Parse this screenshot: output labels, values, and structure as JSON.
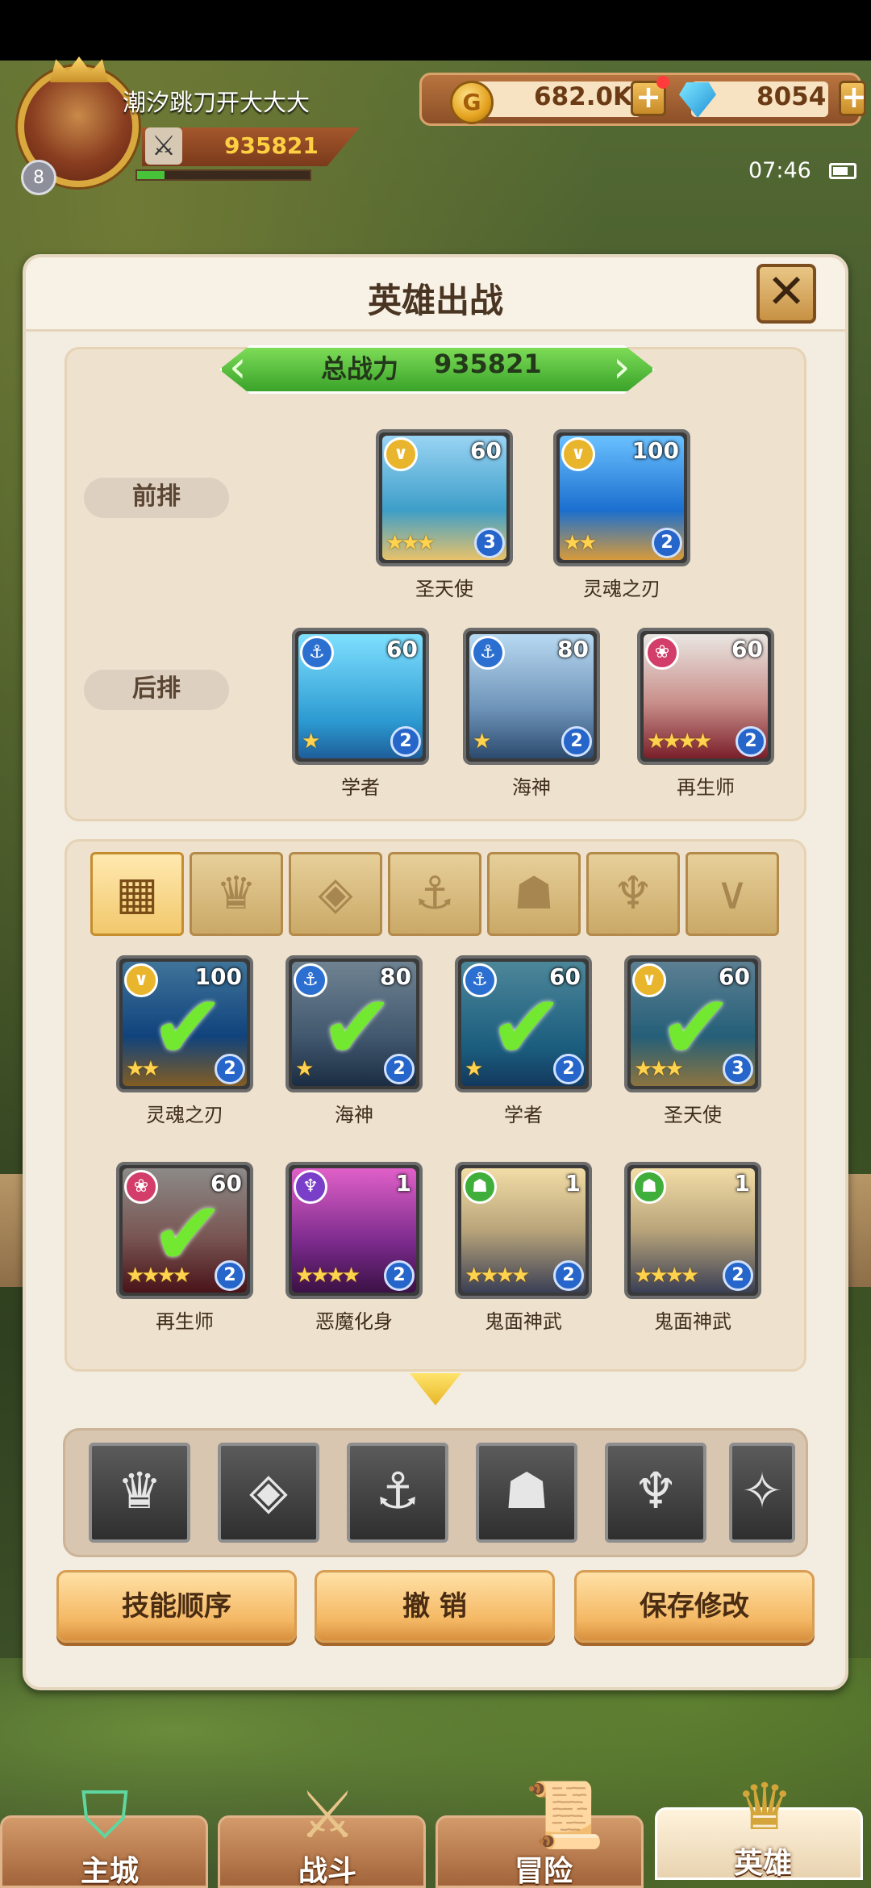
{
  "player": {
    "name": "潮汐跳刀开大大大",
    "power": "935821",
    "level": "8",
    "exp_fraction": 0.16
  },
  "resources": {
    "gold": "682.0K",
    "gems": "8054",
    "gold_icon": "G"
  },
  "status": {
    "time": "07:46"
  },
  "panel": {
    "title": "英雄出战",
    "close": "✕"
  },
  "lineup": {
    "total_power_label": "总战力",
    "total_power_value": "935821",
    "front_label": "前排",
    "back_label": "后排",
    "front": [
      {
        "name": "圣天使",
        "level": "60",
        "stars": "★★★",
        "rank": "3",
        "faction": "light"
      },
      {
        "name": "灵魂之刃",
        "level": "100",
        "stars": "★★",
        "rank": "2",
        "faction": "light"
      }
    ],
    "back": [
      {
        "name": "学者",
        "level": "60",
        "stars": "★",
        "rank": "2",
        "faction": "water"
      },
      {
        "name": "海神",
        "level": "80",
        "stars": "★",
        "rank": "2",
        "faction": "water"
      },
      {
        "name": "再生师",
        "level": "60",
        "stars": "★★★★",
        "rank": "2",
        "faction": "nature"
      }
    ]
  },
  "filters": [
    "grid-icon",
    "crown-icon",
    "diamond-icon",
    "anchor-icon",
    "beast-icon",
    "horns-icon",
    "wing-icon"
  ],
  "roster": [
    {
      "name": "灵魂之刃",
      "level": "100",
      "stars": "★★",
      "rank": "2",
      "selected": true
    },
    {
      "name": "海神",
      "level": "80",
      "stars": "★",
      "rank": "2",
      "selected": true
    },
    {
      "name": "学者",
      "level": "60",
      "stars": "★",
      "rank": "2",
      "selected": true
    },
    {
      "name": "圣天使",
      "level": "60",
      "stars": "★★★",
      "rank": "3",
      "selected": true
    },
    {
      "name": "再生师",
      "level": "60",
      "stars": "★★★★",
      "rank": "2",
      "selected": true
    },
    {
      "name": "恶魔化身",
      "level": "1",
      "stars": "★★★★",
      "rank": "2",
      "selected": false
    },
    {
      "name": "鬼面神武",
      "level": "1",
      "stars": "★★★★",
      "rank": "2",
      "selected": false
    },
    {
      "name": "鬼面神武",
      "level": "1",
      "stars": "★★★★",
      "rank": "2",
      "selected": false
    }
  ],
  "buttons": {
    "skill_order": "技能顺序",
    "undo": "撤 销",
    "save": "保存修改"
  },
  "nav": {
    "city": "主城",
    "battle": "战斗",
    "adventure": "冒险",
    "hero": "英雄"
  },
  "colors": {
    "accent_green": "#3aa32a",
    "gold_text": "#ffd042",
    "panel_bg": "#f3ece0"
  }
}
